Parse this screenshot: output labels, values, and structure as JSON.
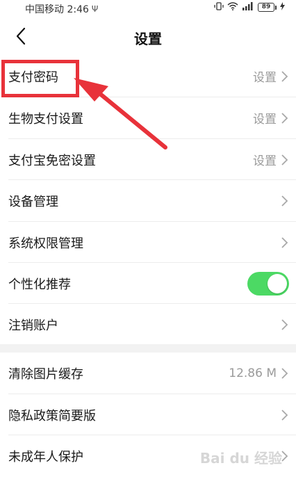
{
  "status_bar": {
    "carrier_time": "中国移动 2:46",
    "battery": "89"
  },
  "nav": {
    "title": "设置"
  },
  "section1": [
    {
      "label": "支付密码",
      "value": "设置"
    },
    {
      "label": "生物支付设置",
      "value": "设置"
    },
    {
      "label": "支付宝免密设置",
      "value": "设置"
    },
    {
      "label": "设备管理",
      "value": ""
    },
    {
      "label": "系统权限管理",
      "value": ""
    },
    {
      "label": "个性化推荐",
      "toggle": true
    },
    {
      "label": "注销账户",
      "value": ""
    }
  ],
  "section2": [
    {
      "label": "清除图片缓存",
      "value": "12.86 M"
    },
    {
      "label": "隐私政策简要版",
      "value": ""
    },
    {
      "label": "未成年人保护",
      "value": ""
    }
  ],
  "watermark": "Bai du 经验",
  "colors": {
    "toggle_on": "#4cd964",
    "annotation_red": "#e8323a"
  }
}
